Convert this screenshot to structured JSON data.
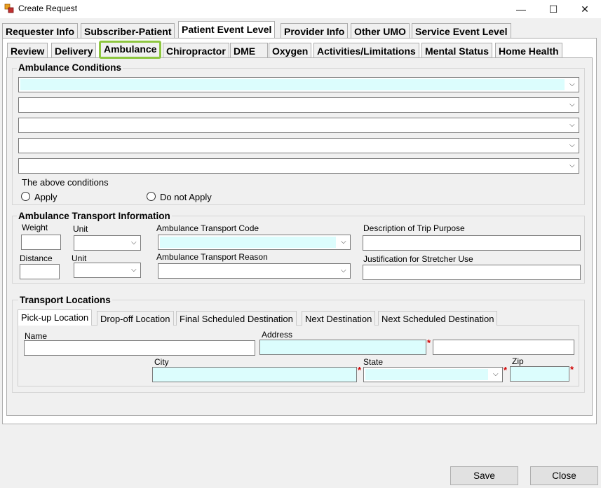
{
  "window": {
    "title": "Create Request",
    "minimize": "—",
    "maximize": "☐",
    "close": "✕"
  },
  "top_tabs": [
    "Requester Info",
    "Subscriber-Patient",
    "Patient Event Level",
    "Provider Info",
    "Other UMO",
    "Service Event Level"
  ],
  "top_tab_selected": "Patient Event Level",
  "sub_tabs": [
    "Review",
    "Delivery",
    "Ambulance",
    "Chiropractor",
    "DME",
    "Oxygen",
    "Activities/Limitations",
    "Mental Status",
    "Home Health"
  ],
  "sub_tab_selected": "Ambulance",
  "highlight_color": "#8dc63f",
  "conditions": {
    "title": "Ambulance Conditions",
    "above_label": "The above conditions",
    "apply": "Apply",
    "not_apply": "Do not Apply"
  },
  "transport_info": {
    "title": "Ambulance Transport Information",
    "weight": "Weight",
    "unit1": "Unit",
    "distance": "Distance",
    "unit2": "Unit",
    "code": "Ambulance Transport Code",
    "reason": "Ambulance Transport Reason",
    "purpose": "Description of Trip Purpose",
    "stretcher": "Justification for Stretcher Use"
  },
  "locations": {
    "title": "Transport Locations",
    "tabs": [
      "Pick-up Location",
      "Drop-off Location",
      "Final Scheduled Destination",
      "Next Destination",
      "Next Scheduled Destination"
    ],
    "name": "Name",
    "address": "Address",
    "city": "City",
    "state": "State",
    "zip": "Zip",
    "required_mark": "*"
  },
  "buttons": {
    "save": "Save",
    "close": "Close"
  },
  "required_color": "#d00000",
  "field_highlight": "#dcfdfd"
}
